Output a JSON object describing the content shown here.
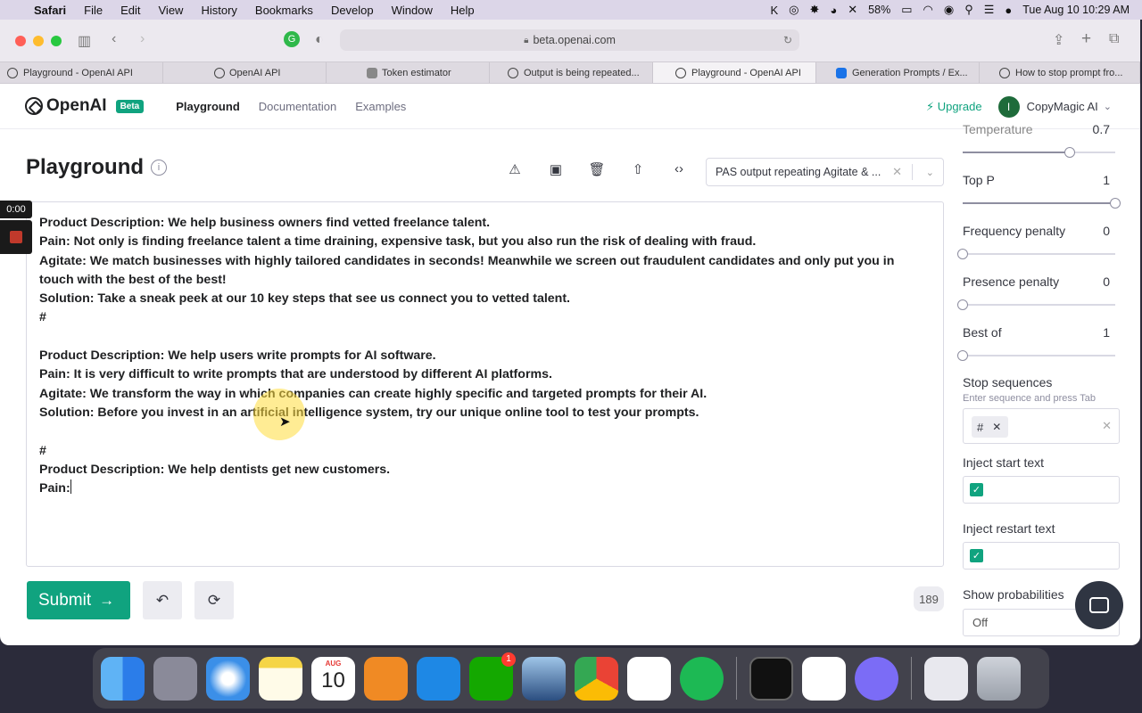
{
  "menubar": {
    "app": "Safari",
    "menus": [
      "File",
      "Edit",
      "View",
      "History",
      "Bookmarks",
      "Develop",
      "Window",
      "Help"
    ],
    "battery": "58%",
    "clock": "Tue Aug 10  10:29 AM"
  },
  "browser": {
    "url": "beta.openai.com",
    "tabs": [
      {
        "label": "Playground - OpenAI API",
        "active": false
      },
      {
        "label": "OpenAI API",
        "active": false
      },
      {
        "label": "Token estimator",
        "active": false
      },
      {
        "label": "Output is being repeated...",
        "active": false
      },
      {
        "label": "Playground - OpenAI API",
        "active": true
      },
      {
        "label": "Generation Prompts / Ex...",
        "active": false
      },
      {
        "label": "How to stop prompt fro...",
        "active": false
      }
    ]
  },
  "header": {
    "brand": "OpenAI",
    "beta": "Beta",
    "nav": [
      "Playground",
      "Documentation",
      "Examples"
    ],
    "upgrade": "Upgrade",
    "avatar_initial": "I",
    "org": "CopyMagic AI"
  },
  "playground": {
    "title": "Playground",
    "preset": "PAS output repeating Agitate & ...",
    "recording_time": "0:00",
    "prompt_lines": [
      "Product Description: We help business owners find vetted freelance talent.",
      "Pain: Not only is finding freelance talent a time draining, expensive task, but you also run the risk of dealing with fraud.",
      "Agitate: We match businesses with highly tailored candidates in seconds! Meanwhile we screen out fraudulent candidates and only put you in touch with the best of the best!",
      "Solution: Take a sneak peek at our 10 key steps that see us connect you to vetted talent.",
      "#",
      "",
      "Product Description: We help users write prompts for AI software.",
      "Pain: It is very difficult to write prompts that are understood by different AI platforms.",
      "Agitate: We transform the way in which companies can create highly specific and targeted prompts for their AI.",
      "Solution: Before you invest in an artificial intelligence system, try our unique online tool to test your prompts.",
      "",
      "#",
      "Product Description: We help dentists get new customers.",
      "Pain:"
    ],
    "submit": "Submit",
    "token_count": "189"
  },
  "settings": {
    "temperature": {
      "label": "Temperature",
      "value": "0.7",
      "fraction": 0.7
    },
    "top_p": {
      "label": "Top P",
      "value": "1",
      "fraction": 1
    },
    "frequency_penalty": {
      "label": "Frequency penalty",
      "value": "0",
      "fraction": 0
    },
    "presence_penalty": {
      "label": "Presence penalty",
      "value": "0",
      "fraction": 0
    },
    "best_of": {
      "label": "Best of",
      "value": "1",
      "fraction": 0
    },
    "stop_sequences": {
      "label": "Stop sequences",
      "help": "Enter sequence and press Tab",
      "chips": [
        "#"
      ]
    },
    "inject_start": {
      "label": "Inject start text",
      "checked": true
    },
    "inject_restart": {
      "label": "Inject restart text",
      "checked": true
    },
    "show_probabilities": {
      "label": "Show probabilities",
      "value": "Off"
    }
  },
  "dock": {
    "calendar_month": "AUG",
    "calendar_day": "10",
    "upwork_badge": "1"
  }
}
